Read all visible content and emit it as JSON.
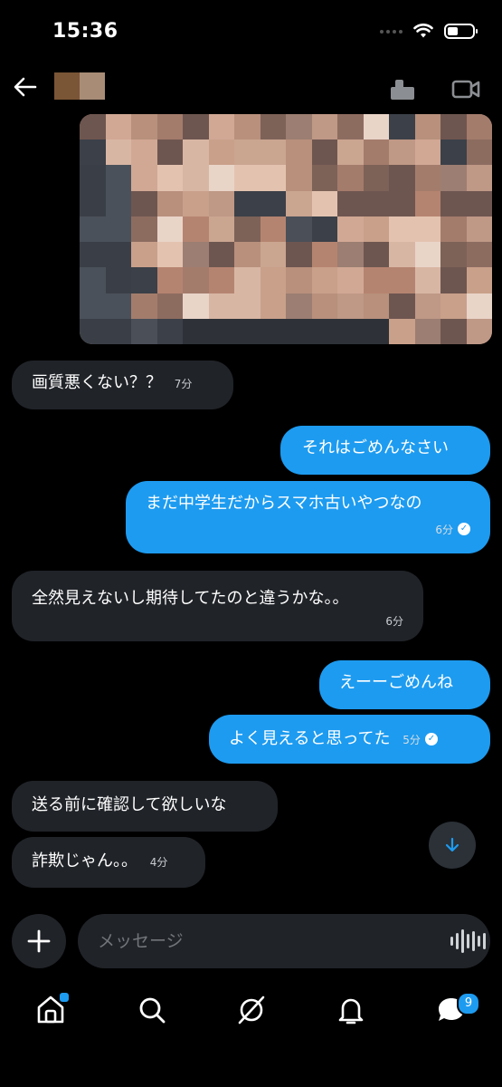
{
  "status_bar": {
    "time": "15:36"
  },
  "header": {
    "avatar_colors": [
      "#7a5536",
      "#a88c76"
    ]
  },
  "colors": {
    "accent": "#1d9bf0",
    "incoming_bubble": "#202328",
    "background": "#000000"
  },
  "messages": [
    {
      "direction": "in",
      "text": "画質悪くない？？",
      "time": "7分"
    },
    {
      "direction": "out",
      "text": "それはごめんなさい"
    },
    {
      "direction": "out",
      "text": "まだ中学生だからスマホ古いやつなの",
      "time": "6分",
      "status_icon": "read-check-icon"
    },
    {
      "direction": "in",
      "text": "全然見えないし期待してたのと違うかな。。",
      "time": "6分"
    },
    {
      "direction": "out",
      "text": "えーーごめんね"
    },
    {
      "direction": "out",
      "text": "よく見えると思ってた",
      "time": "5分",
      "status_icon": "read-check-icon"
    },
    {
      "direction": "in",
      "text": "送る前に確認して欲しいな"
    },
    {
      "direction": "in",
      "text": "詐欺じゃん。。",
      "time": "4分"
    }
  ],
  "composer": {
    "placeholder": "メッセージ"
  },
  "nav": {
    "items": [
      "home-icon",
      "search-icon",
      "grok-icon",
      "notifications-icon",
      "messages-icon"
    ],
    "messages_badge": "9"
  }
}
